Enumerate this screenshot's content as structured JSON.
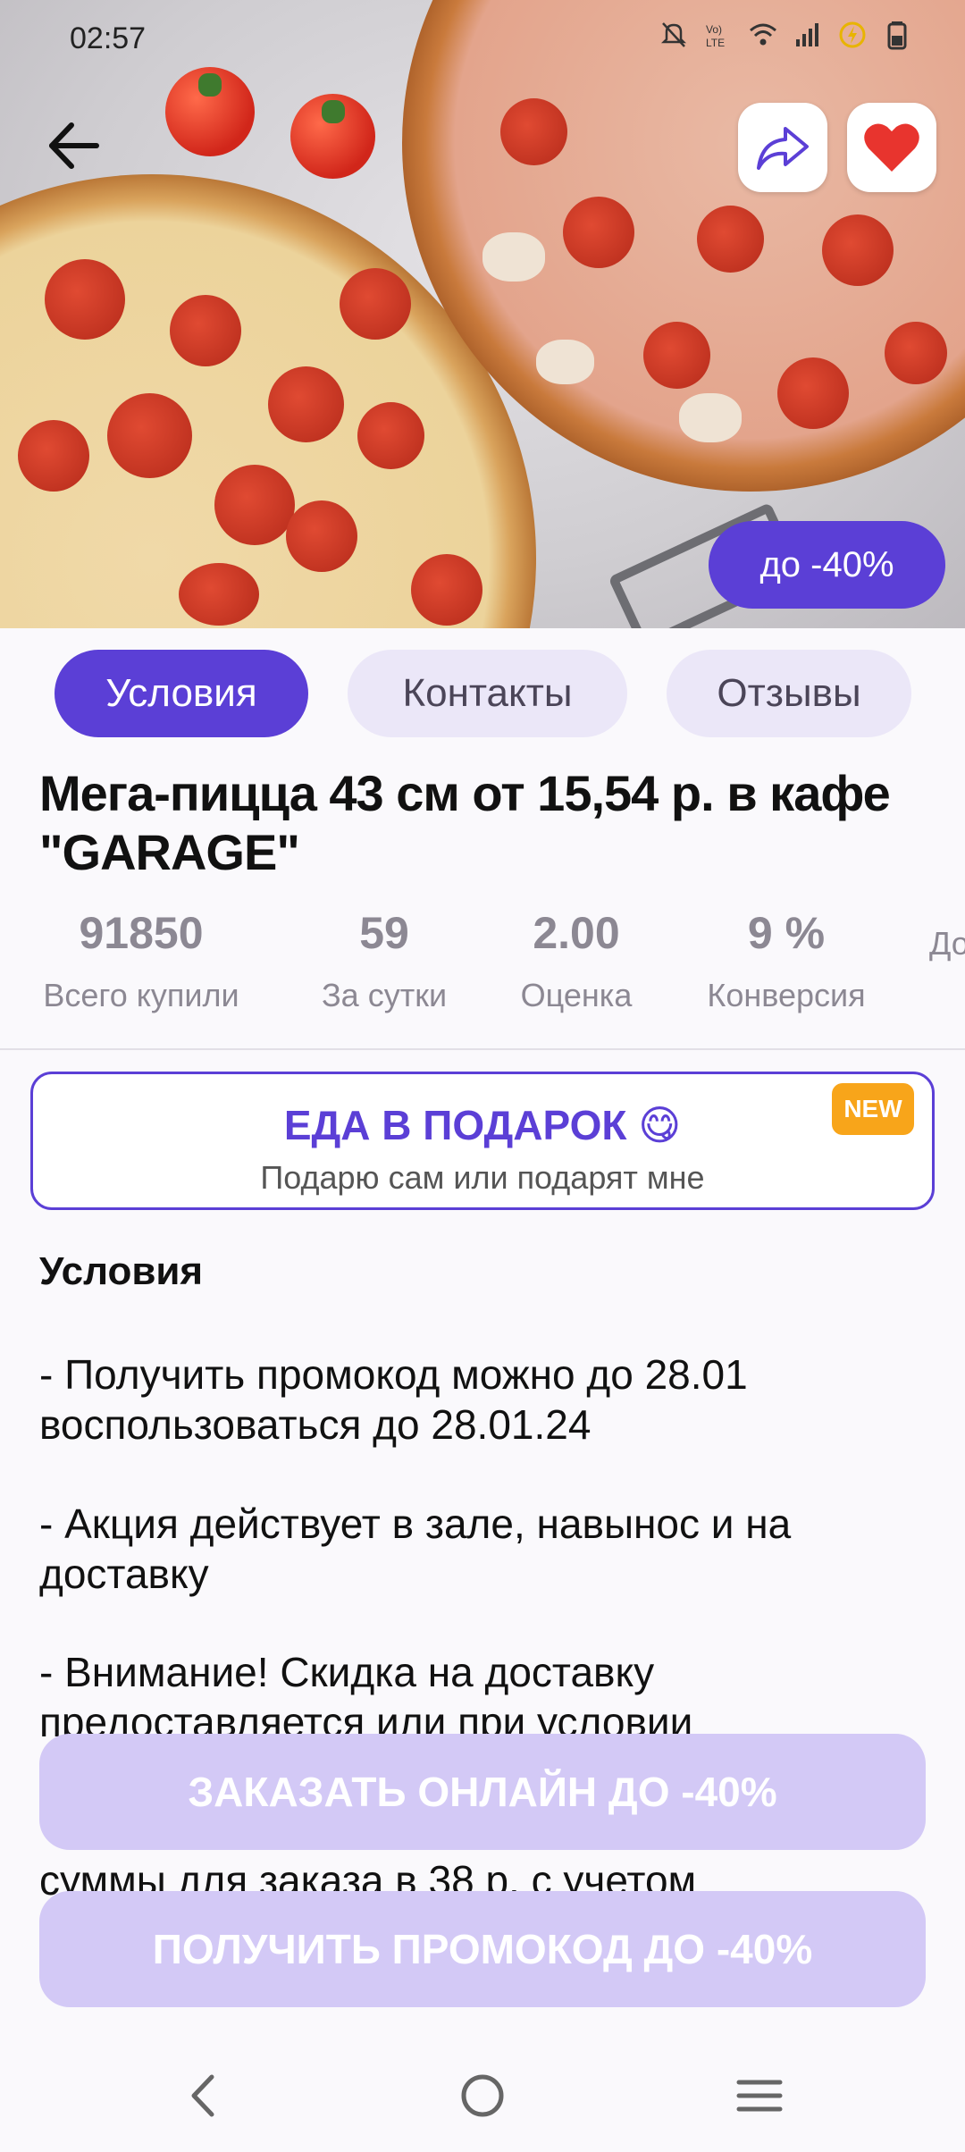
{
  "status_bar": {
    "time": "02:57",
    "icons": [
      "mute-icon",
      "volte-icon",
      "wifi-icon",
      "signal-icon",
      "battery-saver-icon",
      "battery-icon"
    ]
  },
  "hero": {
    "discount_badge": "до -40%"
  },
  "tabs": [
    {
      "label": "Условия",
      "active": true
    },
    {
      "label": "Контакты",
      "active": false
    },
    {
      "label": "Отзывы",
      "active": false
    }
  ],
  "title": "Мега-пицца 43 см от 15,54 р. в кафе \"GARAGE\"",
  "stats": [
    {
      "value": "91850",
      "label": "Всего купили"
    },
    {
      "value": "59",
      "label": "За сутки"
    },
    {
      "value": "2.00",
      "label": "Оценка"
    },
    {
      "value": "9 %",
      "label": "Конверсия"
    },
    {
      "value": "",
      "label": "До"
    }
  ],
  "gift_card": {
    "title": "ЕДА В ПОДАРОК 😋",
    "subtitle": "Подарю сам или подарят мне",
    "badge": "NEW"
  },
  "conditions": {
    "heading": "Условия",
    "paragraphs": [
      "- Получить промокод можно до 28.01 воспользоваться до 28.01.24",
      "- Акция действует в зале, навынос и на доставку",
      "- Внимание! Скидка на доставку предоставляется или при условии",
      "суммы для заказа в 38 р. с учетом"
    ]
  },
  "actions": {
    "order_online": "ЗАКАЗАТЬ ОНЛАЙН ДО -40%",
    "get_promo": "ПОЛУЧИТЬ ПРОМОКОД ДО -40%"
  },
  "colors": {
    "accent": "#5b3fd6",
    "accent_light": "#ebe7f8",
    "cta_disabled": "#d3c9f6",
    "new_badge": "#f8a51a",
    "favorite": "#e8342e"
  }
}
